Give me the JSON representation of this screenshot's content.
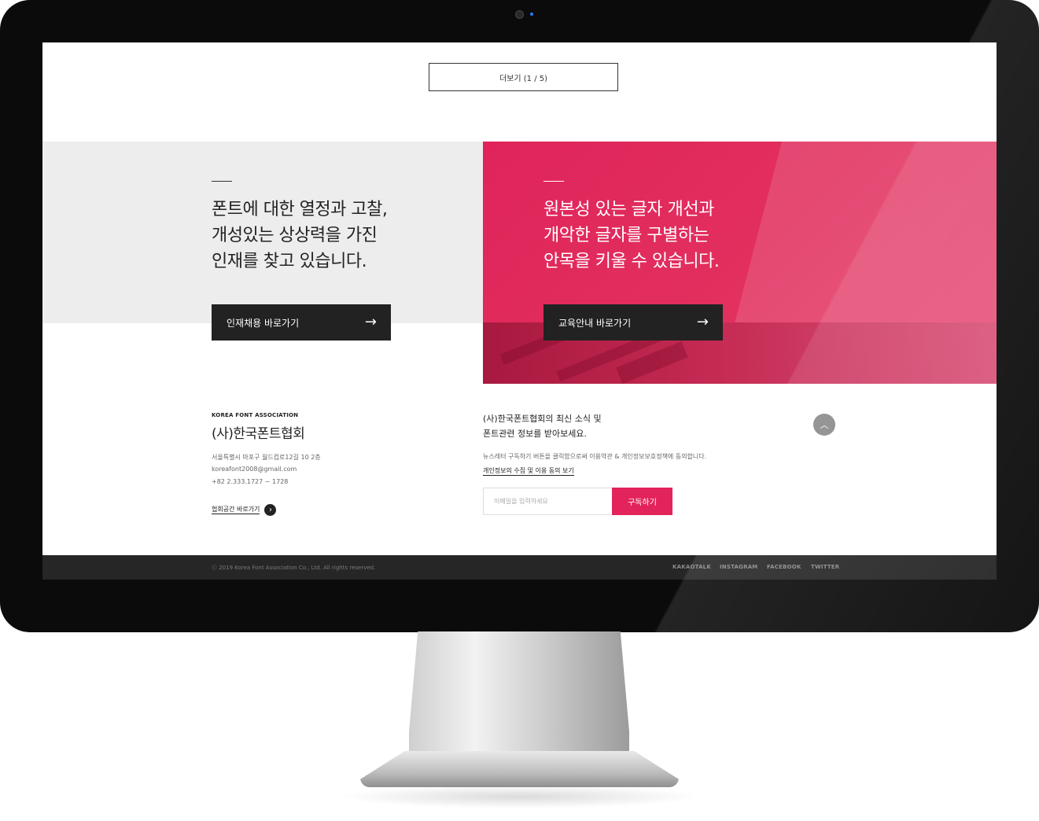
{
  "more_button": {
    "label": "더보기 (1 / 5)"
  },
  "promo_left": {
    "text": "폰트에 대한 열정과 고찰,\n개성있는 상상력을 가진\n인재를 찾고 있습니다.",
    "button_label": "인재채용 바로가기"
  },
  "promo_right": {
    "text": "원본성 있는 글자 개선과\n개악한 글자를 구별하는\n안목을 키울 수 있습니다.",
    "button_label": "교육안내 바로가기"
  },
  "association": {
    "name_en": "KOREA FONT ASSOCIATION",
    "name_ko": "(사)한국폰트협회",
    "address": "서울특별시 마포구 월드컵로12길 10 2층",
    "email": "koreafont2008@gmail.com",
    "phone": "+82 2.333.1727 ~ 1728",
    "link_label": "협회공간 바로가기"
  },
  "newsletter": {
    "title": "(사)한국폰트협회의 최신 소식 및\n폰트관련 정보를 받아보세요.",
    "description": "뉴스레터 구독하기 버튼을 클릭함으로써 이용약관 & 개인정보보호정책에 동의합니다.",
    "privacy_link": "개인정보의 수집 및 이용 동의 보기",
    "email_placeholder": "이메일을 입력하세요",
    "subscribe_label": "구독하기"
  },
  "footer": {
    "copyright": "ⓒ 2019 Korea Font Association Co., Ltd. All rights reserved.",
    "sns": [
      "KAKAOTALK",
      "INSTAGRAM",
      "FACEBOOK",
      "TWITTER"
    ]
  },
  "icons": {
    "arrow": "arrow-right-icon",
    "chevron": "chevron-right-icon",
    "top": "chevron-up-icon"
  },
  "colors": {
    "accent": "#e3245b",
    "dark_button": "#222222",
    "footer_bg": "#262626",
    "left_panel_bg": "#ededed"
  }
}
